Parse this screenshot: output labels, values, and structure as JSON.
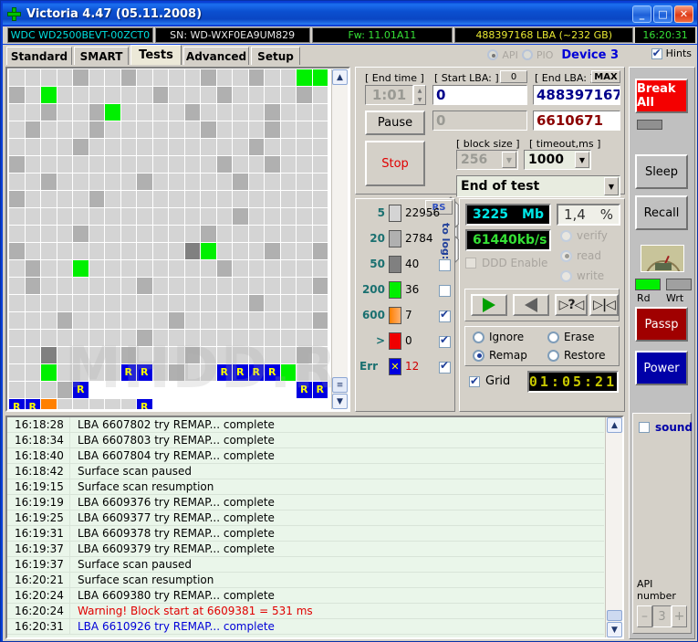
{
  "window": {
    "title": "Victoria 4.47 (05.11.2008)",
    "icon": "green-cross-icon",
    "minimize": "_",
    "maximize": "□",
    "close": "✕"
  },
  "info_strip": {
    "model": "WDC WD2500BEVT-00ZCT0",
    "serial": "SN: WD-WXF0EA9UM829",
    "firmware": "Fw: 11.01A11",
    "capacity": "488397168 LBA (~232 GB)",
    "clock": "16:20:31"
  },
  "tabs": [
    {
      "label": "Standard",
      "active": false
    },
    {
      "label": "SMART",
      "active": false
    },
    {
      "label": "Tests",
      "active": true
    },
    {
      "label": "Advanced",
      "active": false
    },
    {
      "label": "Setup",
      "active": false
    }
  ],
  "device_mode": {
    "api_label": "API",
    "api_selected": true,
    "pio_label": "PIO",
    "pio_selected": false,
    "device": "Device 3",
    "hints_label": "Hints",
    "hints_checked": true
  },
  "controls": {
    "end_time_label": "[ End time ]",
    "end_time_value": "1:01",
    "start_lba_label": "[ Start LBA: ]",
    "start_lba_zero_button": "0",
    "start_lba_value": "0",
    "start_lba_current": "0",
    "end_lba_label": "[ End LBA: ]",
    "end_lba_max_button": "MAX",
    "end_lba_value": "488397167",
    "current_lba_value": "6610671",
    "pause_button": "Pause",
    "stop_button": "Stop",
    "block_size_label": "[ block size ]",
    "block_size_value": "256",
    "timeout_label": "[ timeout,ms ]",
    "timeout_value": "1000",
    "end_action_value": "End of test"
  },
  "legend": {
    "rs_button": "RS",
    "to_log_label": "to log:",
    "rows": [
      {
        "threshold": "5",
        "color": "#d4d4d4",
        "count": "22956",
        "to_log": false,
        "checkbox_visible": false
      },
      {
        "threshold": "20",
        "color": "#b0b0b0",
        "count": "2784",
        "to_log": false,
        "checkbox_visible": false
      },
      {
        "threshold": "50",
        "color": "#808080",
        "count": "40",
        "to_log": false,
        "checkbox_visible": true
      },
      {
        "threshold": "200",
        "color": "#00f000",
        "count": "36",
        "to_log": false,
        "checkbox_visible": true
      },
      {
        "threshold": "600",
        "color": "#ff8000",
        "count": "7",
        "to_log": true,
        "checkbox_visible": true
      },
      {
        "threshold": ">",
        "color": "#f00000",
        "count": "0",
        "to_log": true,
        "checkbox_visible": true
      },
      {
        "threshold": "Err",
        "color": "#0000e0",
        "count": "12",
        "to_log": true,
        "checkbox_visible": true,
        "err": true
      }
    ]
  },
  "readout": {
    "size_value": "3225",
    "size_unit": "Mb",
    "speed_value": "61440",
    "speed_unit": "kb/s",
    "percent_value": "1,4",
    "percent_unit": "%",
    "ddd_enable_label": "DDD Enable",
    "ddd_enable_checked": false,
    "modes": [
      {
        "label": "verify",
        "selected": false
      },
      {
        "label": "read",
        "selected": true
      },
      {
        "label": "write",
        "selected": false
      }
    ]
  },
  "transport": [
    {
      "name": "start-forward",
      "glyph": "▶"
    },
    {
      "name": "start-backward",
      "glyph": "◀"
    },
    {
      "name": "random-seek",
      "glyph": "▷?◁"
    },
    {
      "name": "butterfly-seek",
      "glyph": "▷|◁"
    }
  ],
  "defect_actions": [
    {
      "label": "Ignore",
      "selected": false
    },
    {
      "label": "Erase",
      "selected": false
    },
    {
      "label": "Remap",
      "selected": true
    },
    {
      "label": "Restore",
      "selected": false
    }
  ],
  "grid_toggle": {
    "label": "Grid",
    "checked": true,
    "timer": "01:05:21"
  },
  "sidebar": {
    "break_all": "Break All",
    "sleep": "Sleep",
    "recall": "Recall",
    "rd_label": "Rd",
    "wrt_label": "Wrt",
    "passport": "Passp",
    "power": "Power",
    "sound_label": "sound",
    "sound_checked": false,
    "api_number_label": "API number",
    "api_number_value": "3",
    "api_minus": "–",
    "api_plus": "+"
  },
  "surface_map": {
    "watermark": "MHDD.RU",
    "columns": 21,
    "cells": [
      "g1",
      "g1",
      "g1",
      "g1",
      "g2",
      "g1",
      "g1",
      "g2",
      "g1",
      "g1",
      "g1",
      "g1",
      "g2",
      "g1",
      "g1",
      "g2",
      "g1",
      "g1",
      "grn",
      "grn",
      "g2",
      "g1",
      "grn",
      "g1",
      "g1",
      "g1",
      "g1",
      "g1",
      "g1",
      "g2",
      "g1",
      "g1",
      "g1",
      "g2",
      "g1",
      "g1",
      "g1",
      "g1",
      "g2",
      "g1",
      "g1",
      "g1",
      "g2",
      "g1",
      "g1",
      "g2",
      "grn",
      "g1",
      "g1",
      "g1",
      "g1",
      "g2",
      "g1",
      "g1",
      "g1",
      "g1",
      "g2",
      "g1",
      "g1",
      "g1",
      "g1",
      "g2",
      "g1",
      "g1",
      "g1",
      "g2",
      "g1",
      "g1",
      "g1",
      "g1",
      "g1",
      "g1",
      "g2",
      "g1",
      "g1",
      "g1",
      "g2",
      "g1",
      "g1",
      "g1",
      "g1",
      "g1",
      "g1",
      "g1",
      "g2",
      "g1",
      "g1",
      "g1",
      "g1",
      "g1",
      "g1",
      "g1",
      "g1",
      "g1",
      "g1",
      "g2",
      "g1",
      "g1",
      "g1",
      "g1",
      "g2",
      "g1",
      "g1",
      "g1",
      "g1",
      "g1",
      "g1",
      "g1",
      "g1",
      "g1",
      "g1",
      "g1",
      "g1",
      "g2",
      "g1",
      "g1",
      "g2",
      "g1",
      "g1",
      "g1",
      "g1",
      "g1",
      "g2",
      "g1",
      "g1",
      "g1",
      "g1",
      "g1",
      "g2",
      "g1",
      "g1",
      "g1",
      "g1",
      "g1",
      "g2",
      "g1",
      "g1",
      "g1",
      "g1",
      "g1",
      "g2",
      "g1",
      "g1",
      "g1",
      "g1",
      "g2",
      "g1",
      "g1",
      "g1",
      "g1",
      "g1",
      "g1",
      "g1",
      "g1",
      "g1",
      "g1",
      "g1",
      "g1",
      "g1",
      "g1",
      "g1",
      "g1",
      "g1",
      "g1",
      "g1",
      "g1",
      "g1",
      "g1",
      "g1",
      "g1",
      "g1",
      "g1",
      "g1",
      "g1",
      "g2",
      "g1",
      "g1",
      "g1",
      "g1",
      "g1",
      "g1",
      "g1",
      "g1",
      "g1",
      "g2",
      "g1",
      "g1",
      "g1",
      "g1",
      "g1",
      "g1",
      "g1",
      "g2",
      "g1",
      "g1",
      "g1",
      "g1",
      "g1",
      "g1",
      "g1",
      "g2",
      "g1",
      "g1",
      "g1",
      "g1",
      "g1",
      "g1",
      "g1",
      "g1",
      "g1",
      "g1",
      "g3",
      "grn",
      "g1",
      "g1",
      "g1",
      "g2",
      "g1",
      "g1",
      "g2",
      "g1",
      "g2",
      "g1",
      "g1",
      "grn",
      "g1",
      "g1",
      "g1",
      "g1",
      "g1",
      "g1",
      "g1",
      "g1",
      "g2",
      "g1",
      "g1",
      "g1",
      "g1",
      "g1",
      "g1",
      "g1",
      "g2",
      "g1",
      "g1",
      "g1",
      "g1",
      "g1",
      "g1",
      "g2",
      "g1",
      "g1",
      "g1",
      "g1",
      "g1",
      "g1",
      "g1",
      "g1",
      "g1",
      "g1",
      "g2",
      "g1",
      "g1",
      "g1",
      "g1",
      "g1",
      "g1",
      "g1",
      "g1",
      "g1",
      "g1",
      "g1",
      "g1",
      "g1",
      "g1",
      "g1",
      "g2",
      "g1",
      "g1",
      "g1",
      "g1",
      "g1",
      "g1",
      "g1",
      "g2",
      "g1",
      "g1",
      "g1",
      "g1",
      "g1",
      "g1",
      "g2",
      "g1",
      "g1",
      "g1",
      "g1",
      "g1",
      "g1",
      "g1",
      "g1",
      "g2",
      "g1",
      "g1",
      "g1",
      "g1",
      "g1",
      "g1",
      "g1",
      "g1",
      "g2",
      "g1",
      "g1",
      "g1",
      "g1",
      "g1",
      "g1",
      "g1",
      "g1",
      "g1",
      "g1",
      "g1",
      "g1",
      "g1",
      "g3",
      "g1",
      "g1",
      "g1",
      "g1",
      "g2",
      "g1",
      "g1",
      "g1",
      "g2",
      "g1",
      "g1",
      "g1",
      "g1",
      "g1",
      "g1",
      "g2",
      "g1",
      "g1",
      "g1",
      "grn",
      "g1",
      "g1",
      "g1",
      "g1",
      "R",
      "R",
      "g1",
      "g2",
      "g1",
      "g1",
      "R",
      "R",
      "R",
      "R",
      "grn",
      "g1",
      "g1",
      "g1",
      "g1",
      "g1",
      "g2",
      "R",
      "w",
      "w",
      "w",
      "w",
      "w",
      "w",
      "w",
      "w",
      "w",
      "w",
      "w",
      "w",
      "w",
      "R",
      "R",
      "R",
      "R",
      "org",
      "g1",
      "g1",
      "g1",
      "g1",
      "g1",
      "R",
      "w",
      "w",
      "w",
      "w",
      "w",
      "w",
      "w",
      "w",
      "w",
      "w"
    ]
  },
  "log": {
    "entries": [
      {
        "time": "16:18:28",
        "message": "LBA 6607802 try REMAP... complete",
        "style": "normal"
      },
      {
        "time": "16:18:34",
        "message": "LBA 6607803 try REMAP... complete",
        "style": "normal"
      },
      {
        "time": "16:18:40",
        "message": "LBA 6607804 try REMAP... complete",
        "style": "normal"
      },
      {
        "time": "16:18:42",
        "message": "Surface scan paused",
        "style": "normal"
      },
      {
        "time": "16:19:15",
        "message": "Surface scan resumption",
        "style": "normal"
      },
      {
        "time": "16:19:19",
        "message": "LBA 6609376 try REMAP... complete",
        "style": "normal"
      },
      {
        "time": "16:19:25",
        "message": "LBA 6609377 try REMAP... complete",
        "style": "normal"
      },
      {
        "time": "16:19:31",
        "message": "LBA 6609378 try REMAP... complete",
        "style": "normal"
      },
      {
        "time": "16:19:37",
        "message": "LBA 6609379 try REMAP... complete",
        "style": "normal"
      },
      {
        "time": "16:19:37",
        "message": "Surface scan paused",
        "style": "normal"
      },
      {
        "time": "16:20:21",
        "message": "Surface scan resumption",
        "style": "normal"
      },
      {
        "time": "16:20:24",
        "message": "LBA 6609380 try REMAP... complete",
        "style": "normal"
      },
      {
        "time": "16:20:24",
        "message": "Warning! Block start at 6609381 = 531 ms",
        "style": "red"
      },
      {
        "time": "16:20:31",
        "message": "LBA 6610926 try REMAP... complete",
        "style": "blue"
      }
    ]
  }
}
